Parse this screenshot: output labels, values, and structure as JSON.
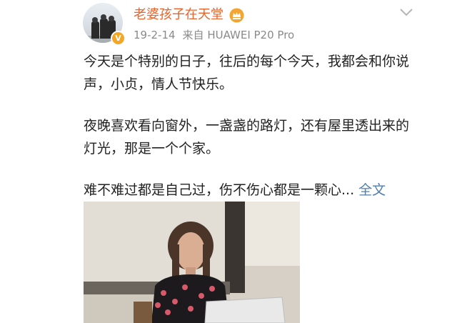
{
  "header": {
    "username": "老婆孩子在天堂",
    "date": "19-2-14",
    "source": "来自 HUAWEI P20 Pro",
    "avatar_icon": "avatar-photo",
    "badge_icon": "verified-v-icon",
    "badge_glyph": "V",
    "vip_icon": "vip-crown-icon",
    "menu_icon": "chevron-down-icon",
    "colors": {
      "username": "#e8642c",
      "badge": "#f5a623",
      "meta": "#8a8a8a"
    }
  },
  "post": {
    "paragraphs": [
      "今天是个特别的日子，往后的每个今天，我都会和你说声，小贞，情人节快乐。",
      "夜晚喜欢看向窗外，一盏盏的路灯，还有屋里透出来的灯光，那是一个个家。"
    ],
    "truncated_text": "难不难过都是自己过，伤不伤心都是一颗心...",
    "expand_label": " 全文",
    "colors": {
      "text": "#222222",
      "link": "#507daf"
    }
  },
  "media": {
    "photo_description_icon": "post-photo"
  }
}
